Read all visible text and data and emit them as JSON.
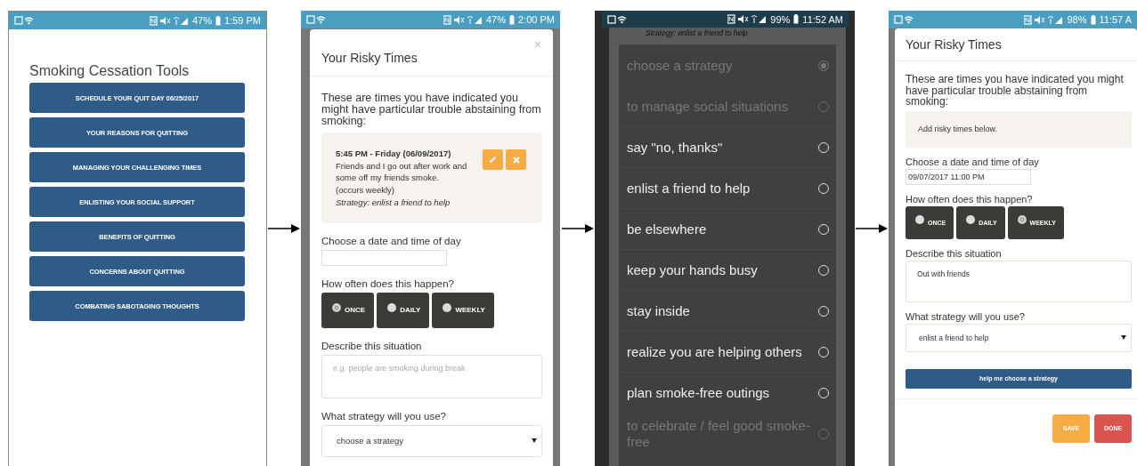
{
  "screens": [
    {
      "kind": "menu",
      "status_bar": {
        "battery": "47%",
        "time": "1:59 PM"
      },
      "title": "Smoking Cessation Tools",
      "buttons": [
        "SCHEDULE YOUR QUIT DAY 06/25/2017",
        "YOUR REASONS FOR QUITTING",
        "MANAGING YOUR CHALLENGING TIMES",
        "ENLISTING YOUR SOCIAL SUPPORT",
        "BENEFITS OF QUITTING",
        "CONCERNS ABOUT QUITTING",
        "COMBATING SABOTAGING THOUGHTS"
      ]
    },
    {
      "kind": "form",
      "status_bar": {
        "battery": "47%",
        "time": "2:00 PM"
      },
      "close": "×",
      "title": "Your Risky Times",
      "intro": "These are times you have indicated you might have particular trouble abstaining from smoking:",
      "entries": [
        {
          "time": "5:45 PM - Friday (06/09/2017)",
          "description": "Friends and I go out after work and some off my friends smoke.",
          "frequency": "(occurs weekly)",
          "strategy": "Strategy: enlist a friend to help"
        }
      ],
      "date_label": "Choose a date and time of day",
      "frequency_label": "How often does this happen?",
      "frequency_options": [
        {
          "label": "ONCE",
          "selected": true
        },
        {
          "label": "DAILY",
          "selected": false
        },
        {
          "label": "WEEKLY",
          "selected": false
        }
      ],
      "describe_label": "Describe this situation",
      "describe_placeholder": "e.g. people are smoking during break",
      "strategy_label": "What strategy will you use?",
      "strategy_value": "choose a strategy"
    },
    {
      "kind": "picker",
      "status_bar": {
        "battery": "99%",
        "time": "11:52 AM"
      },
      "background_text": "Strategy: enlist a friend to help",
      "options": [
        {
          "label": "choose a strategy",
          "disabled": true,
          "selected": true
        },
        {
          "label": "to manage social situations",
          "disabled": true,
          "selected": false
        },
        {
          "label": "say \"no, thanks\"",
          "disabled": false,
          "selected": false
        },
        {
          "label": "enlist a friend to help",
          "disabled": false,
          "selected": false
        },
        {
          "label": "be elsewhere",
          "disabled": false,
          "selected": false
        },
        {
          "label": "keep your hands busy",
          "disabled": false,
          "selected": false
        },
        {
          "label": "stay inside",
          "disabled": false,
          "selected": false
        },
        {
          "label": "realize you are helping others",
          "disabled": false,
          "selected": false
        },
        {
          "label": "plan smoke-free outings",
          "disabled": false,
          "selected": false
        },
        {
          "label": "to celebrate / feel good smoke-free",
          "disabled": true,
          "selected": false
        }
      ]
    },
    {
      "kind": "form",
      "status_bar": {
        "battery": "98%",
        "time": "11:57 A"
      },
      "title": "Your Risky Times",
      "intro": "These are times you have indicated you might have particular trouble abstaining from smoking:",
      "empty_message": "Add risky times below.",
      "date_label": "Choose a date and time of day",
      "date_value": "09/07/2017 11:00 PM",
      "frequency_label": "How often does this happen?",
      "frequency_options": [
        {
          "label": "ONCE",
          "selected": false
        },
        {
          "label": "DAILY",
          "selected": false
        },
        {
          "label": "WEEKLY",
          "selected": true
        }
      ],
      "describe_label": "Describe this situation",
      "describe_value": "Out with friends",
      "strategy_label": "What strategy will you use?",
      "strategy_value": "enlist a friend to help",
      "help_button": "help me choose a strategy",
      "actions": [
        {
          "label": "SAVE",
          "kind": "save"
        },
        {
          "label": "DONE",
          "kind": "done"
        }
      ]
    }
  ]
}
